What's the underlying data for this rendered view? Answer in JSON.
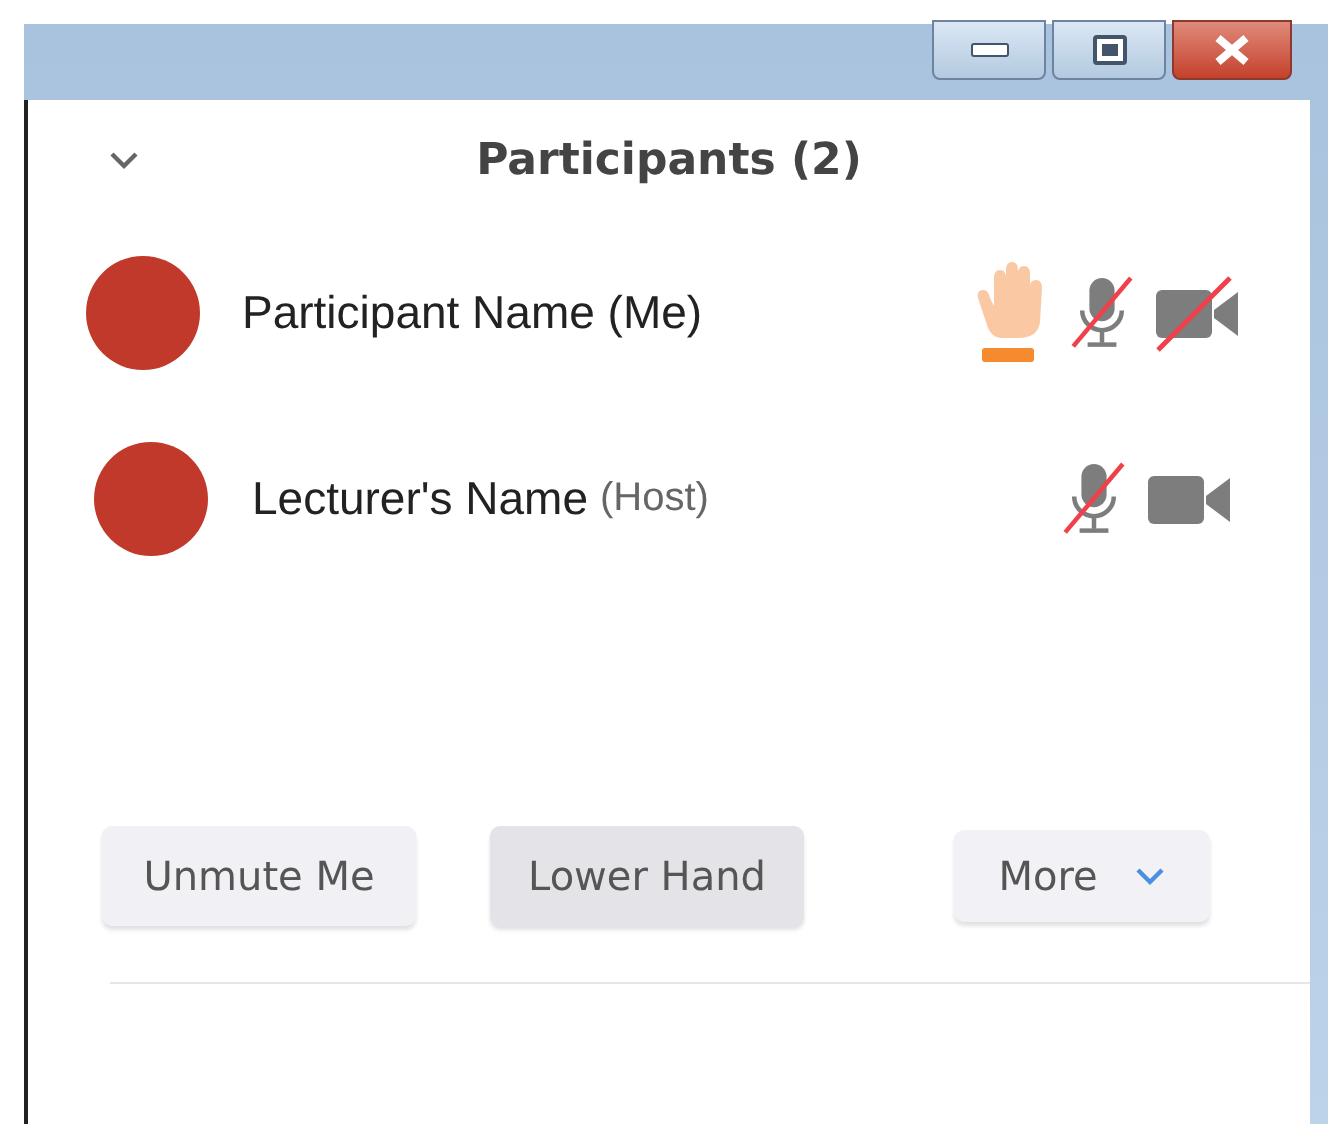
{
  "panel": {
    "title": "Participants (2)",
    "expanded": true
  },
  "participants": [
    {
      "name": "Participant Name (Me)",
      "hand_raised": true,
      "muted": true,
      "video_off": true
    },
    {
      "name": "Lecturer's Name",
      "role": "(Host)",
      "hand_raised": false,
      "muted": true,
      "video_off": false
    }
  ],
  "buttons": [
    {
      "label": "Unmute Me",
      "kind": "plain",
      "pressed": false
    },
    {
      "label": "Lower Hand",
      "kind": "plain",
      "pressed": true
    },
    {
      "label": "More",
      "kind": "dropdown",
      "pressed": false
    }
  ]
}
